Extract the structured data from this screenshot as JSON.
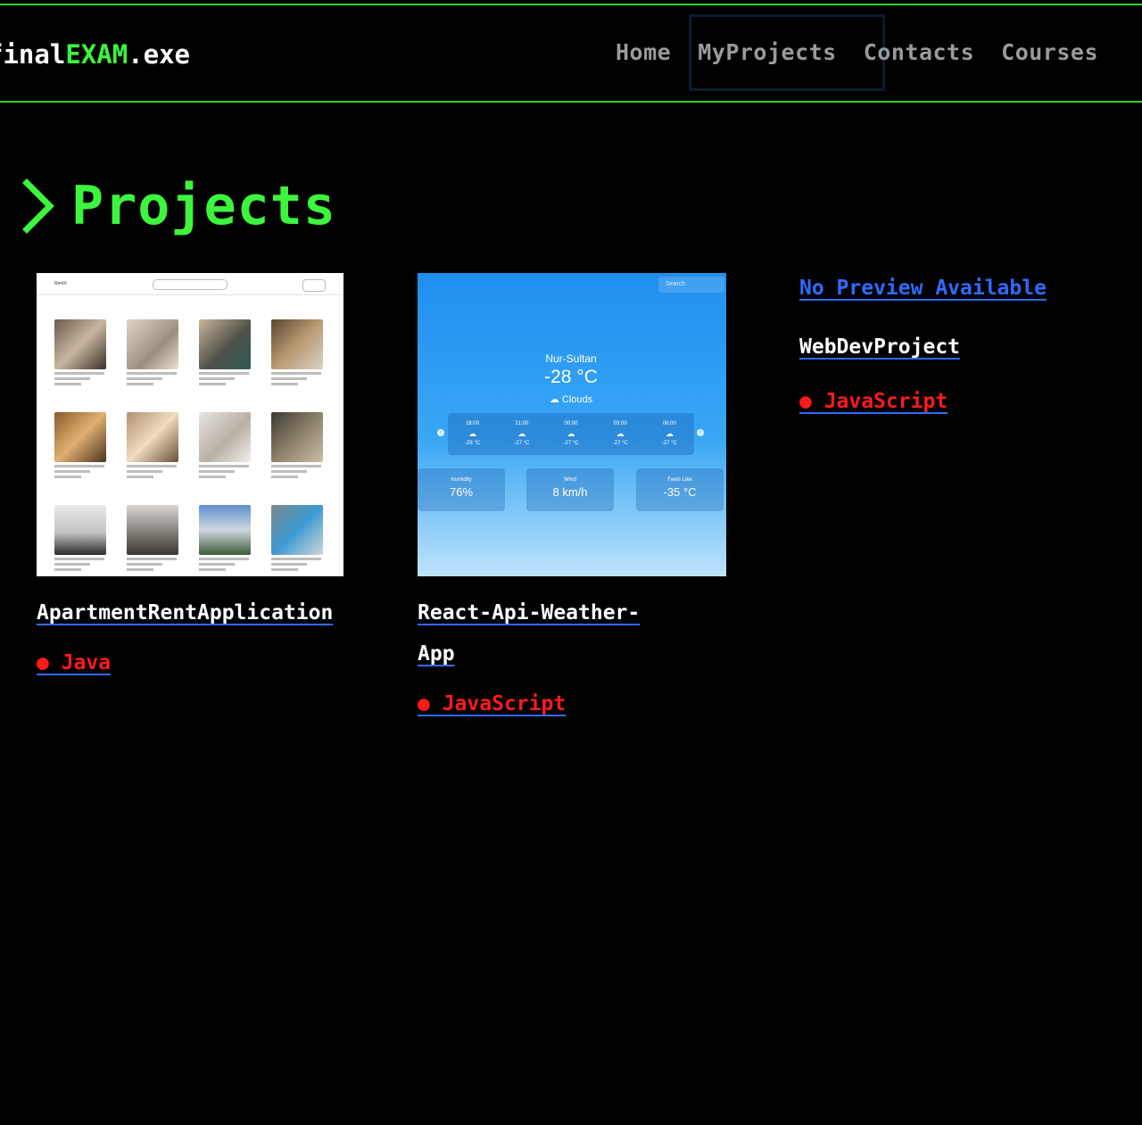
{
  "header": {
    "brand_prefix": "finalEXAM.exe",
    "brand_part1": "final",
    "brand_part2": "EXAM",
    "brand_part3": ".exe",
    "nav": [
      "Home",
      "MyProjects",
      "Contacts",
      "Courses"
    ],
    "active_nav": "MyProjects"
  },
  "section": {
    "title": "Projects"
  },
  "projects": [
    {
      "name": "ApartmentRentApplication",
      "language": "● Java",
      "preview": "apartment-listing-grid"
    },
    {
      "name_line1": "React-Api-Weather-",
      "name_line2": "App",
      "language": "● JavaScript",
      "preview": "weather-app",
      "weather": {
        "search": "Search",
        "city": "Nur-Sultan",
        "temp": "-28 °C",
        "condition": "Clouds",
        "forecast": [
          {
            "time": "18:00",
            "temp": "-28 °C"
          },
          {
            "time": "21:00",
            "temp": "-27 °C"
          },
          {
            "time": "00:00",
            "temp": "-27 °C"
          },
          {
            "time": "03:00",
            "temp": "-27 °C"
          },
          {
            "time": "06:00",
            "temp": "-27 °C"
          }
        ],
        "stats": [
          {
            "label": "Humidity",
            "value": "76%"
          },
          {
            "label": "Wind",
            "value": "8 km/h"
          },
          {
            "label": "Feels Like",
            "value": "-35 °C"
          }
        ]
      }
    },
    {
      "no_preview": "No Preview Available",
      "name": "WebDevProject",
      "language": "● JavaScript"
    }
  ],
  "colors": {
    "background": "#000000",
    "accent_green": "#3df53d",
    "link_blue": "#2f6bff",
    "lang_red": "#ff1a1a"
  }
}
